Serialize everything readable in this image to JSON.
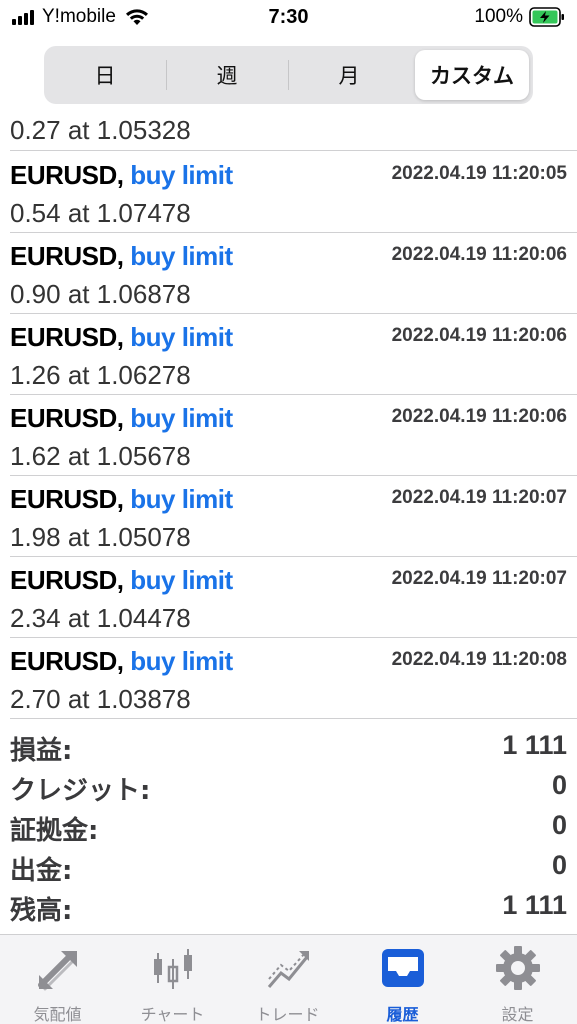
{
  "status_bar": {
    "carrier": "Y!mobile",
    "time": "7:30",
    "battery": "100%"
  },
  "period_tabs": [
    "日",
    "週",
    "月",
    "カスタム"
  ],
  "active_period": "カスタム",
  "partial_row": {
    "volume": "0.27 at 1.05328"
  },
  "orders": [
    {
      "symbol": "EURUSD,",
      "type": "buy limit",
      "datetime": "2022.04.19 11:20:05",
      "volume": "0.54 at 1.07478"
    },
    {
      "symbol": "EURUSD,",
      "type": "buy limit",
      "datetime": "2022.04.19 11:20:06",
      "volume": "0.90 at 1.06878"
    },
    {
      "symbol": "EURUSD,",
      "type": "buy limit",
      "datetime": "2022.04.19 11:20:06",
      "volume": "1.26 at 1.06278"
    },
    {
      "symbol": "EURUSD,",
      "type": "buy limit",
      "datetime": "2022.04.19 11:20:06",
      "volume": "1.62 at 1.05678"
    },
    {
      "symbol": "EURUSD,",
      "type": "buy limit",
      "datetime": "2022.04.19 11:20:07",
      "volume": "1.98 at 1.05078"
    },
    {
      "symbol": "EURUSD,",
      "type": "buy limit",
      "datetime": "2022.04.19 11:20:07",
      "volume": "2.34 at 1.04478"
    },
    {
      "symbol": "EURUSD,",
      "type": "buy limit",
      "datetime": "2022.04.19 11:20:08",
      "volume": "2.70 at 1.03878"
    }
  ],
  "summary": [
    {
      "label": "損益:",
      "value": "1 111"
    },
    {
      "label": "クレジット:",
      "value": "0"
    },
    {
      "label": "証拠金:",
      "value": "0"
    },
    {
      "label": "出金:",
      "value": "0"
    },
    {
      "label": "残高:",
      "value": "1 111"
    }
  ],
  "tabbar": [
    {
      "label": "気配値",
      "icon": "quotes-icon"
    },
    {
      "label": "チャート",
      "icon": "candlestick-chart-icon"
    },
    {
      "label": "トレード",
      "icon": "trade-icon"
    },
    {
      "label": "履歴",
      "icon": "history-inbox-icon"
    },
    {
      "label": "設定",
      "icon": "gear-icon"
    }
  ],
  "active_tab": "履歴",
  "colors": {
    "accent": "#1a73e8",
    "tab_active": "#1a5ed8",
    "tab_inactive": "#8e8e93",
    "battery_green": "#34c759"
  }
}
